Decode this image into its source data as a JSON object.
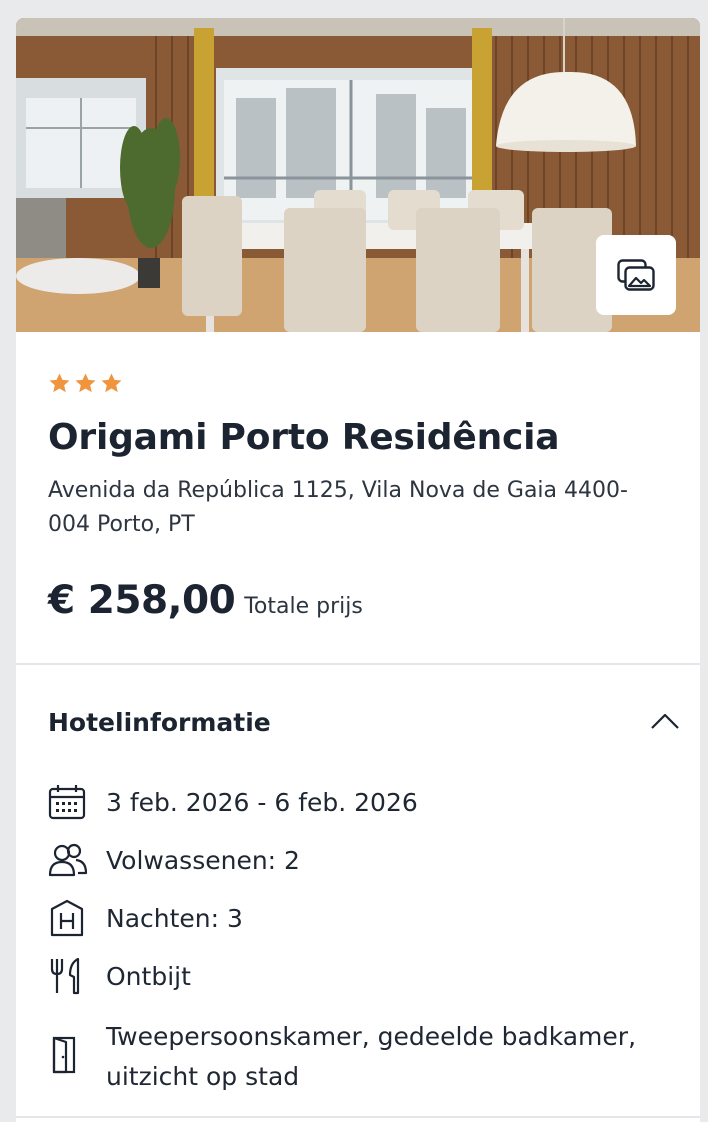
{
  "hotel": {
    "stars": 3,
    "star_color": "#f0943d",
    "name": "Origami Porto Residência",
    "address": "Avenida da República 1125, Vila Nova de Gaia 4400-004 Porto, PT",
    "price": "€ 258,00",
    "price_label": "Totale prijs",
    "photo_button_icon": "photo-gallery-icon"
  },
  "hotel_info": {
    "title": "Hotelinformatie",
    "expanded": true,
    "items": [
      {
        "icon": "calendar-icon",
        "text": "3 feb. 2026 - 6 feb. 2026"
      },
      {
        "icon": "users-icon",
        "text": "Volwassenen: 2"
      },
      {
        "icon": "hotel-icon",
        "text": "Nachten: 3"
      },
      {
        "icon": "cutlery-icon",
        "text": "Ontbijt"
      },
      {
        "icon": "door-icon",
        "text": "Tweepersoonskamer, gedeelde badkamer, uitzicht op stad"
      }
    ]
  }
}
